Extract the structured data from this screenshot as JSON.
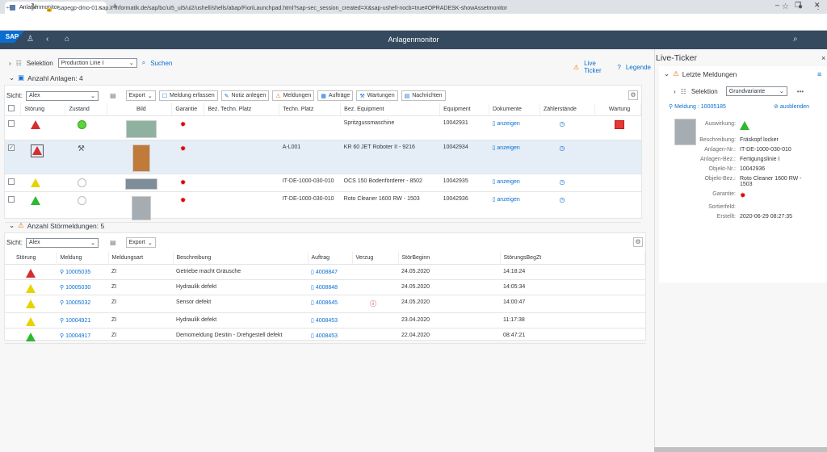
{
  "browser": {
    "tab_title": "Anlagenmonitor",
    "url": "sapegp-dmo-01.sap.it-informatik.de/sap/bc/ui5_ui5/ui2/ushell/shells/abap/FioriLaunchpad.html?sap-sec_session_created=X&sap-ushell-nocb=true#OPRADESK-showAssetmonitor"
  },
  "shell": {
    "title": "Anlagenmonitor",
    "logo": "SAP"
  },
  "filter": {
    "label": "Selektion",
    "variant": "Production Line I",
    "search": "Suchen",
    "live_ticker": "Live Ticker",
    "legend": "Legende"
  },
  "assets": {
    "title": "Anzahl Anlagen: 4",
    "view_label": "Sicht:",
    "view_value": "Alex",
    "export": "Export",
    "buttons": [
      "Meldung erfassen",
      "Notiz anlegen",
      "Meldungen",
      "Aufträge",
      "Wartungen",
      "Nachrichten"
    ],
    "columns": [
      "Störung",
      "Zustand",
      "Bild",
      "Garantie",
      "Bez. Techn. Platz",
      "Techn. Platz",
      "Bez. Equipment",
      "Equipment",
      "Dokumente",
      "Zählerstände",
      "Wartung"
    ],
    "rows": [
      {
        "stoerung": "red",
        "zustand": "green-circle",
        "platz": "",
        "bez_equipment": "Spritzgussmaschine",
        "equipment": "10042931",
        "doc": "anzeigen",
        "wartung": true,
        "selected": false
      },
      {
        "stoerung": "red",
        "zustand": "tool-icon",
        "platz": "A-L001",
        "bez_equipment": "KR 60 JET Roboter II - 9216",
        "equipment": "10042934",
        "doc": "anzeigen",
        "wartung": false,
        "selected": true
      },
      {
        "stoerung": "yellow",
        "zustand": "empty-circle",
        "platz": "IT-DE-1000-030-010",
        "bez_equipment": "OCS 150 Bodenförderer - 8502",
        "equipment": "10042935",
        "doc": "anzeigen",
        "wartung": false,
        "selected": false
      },
      {
        "stoerung": "green",
        "zustand": "empty-circle",
        "platz": "IT-DE-1000-030-010",
        "bez_equipment": "Roto Cleaner 1600 RW - 1503",
        "equipment": "10042936",
        "doc": "anzeigen",
        "wartung": false,
        "selected": false
      }
    ]
  },
  "faults": {
    "title": "Anzahl Störmeldungen: 5",
    "view_label": "Sicht:",
    "view_value": "Alex",
    "export": "Export",
    "columns": [
      "Störung",
      "Meldung",
      "Meldungsart",
      "Beschreibung",
      "Auftrag",
      "Verzug",
      "StörBeginn",
      "StörungsBegZt"
    ],
    "rows": [
      {
        "stoerung": "red",
        "meldung": "10005035",
        "art": "ZI",
        "beschreibung": "Getriebe macht Gräusche",
        "auftrag": "4008847",
        "verzug": false,
        "beginn": "24.05.2020",
        "zeit": "14:18:24"
      },
      {
        "stoerung": "yellow",
        "meldung": "10005030",
        "art": "ZI",
        "beschreibung": "Hydraulik defekt",
        "auftrag": "4008848",
        "verzug": false,
        "beginn": "24.05.2020",
        "zeit": "14:05:34"
      },
      {
        "stoerung": "yellow",
        "meldung": "10005032",
        "art": "ZI",
        "beschreibung": "Sensor defekt",
        "auftrag": "4008645",
        "verzug": true,
        "beginn": "24.05.2020",
        "zeit": "14:00:47"
      },
      {
        "stoerung": "yellow",
        "meldung": "10004921",
        "art": "ZI",
        "beschreibung": "Hydraulik defekt",
        "auftrag": "4008453",
        "verzug": false,
        "beginn": "23.04.2020",
        "zeit": "11:17:38"
      },
      {
        "stoerung": "green",
        "meldung": "10004917",
        "art": "ZI",
        "beschreibung": "Demomeldung Desitin - Drehgestell defekt",
        "auftrag": "4008453",
        "verzug": false,
        "beginn": "22.04.2020",
        "zeit": "08:47:21"
      }
    ]
  },
  "ticker": {
    "title": "Live-Ticker",
    "section": "Letzte Meldungen",
    "selektion": "Selektion",
    "variant": "Grundvariante",
    "meldung_link": "Meldung : 10005185",
    "ausblenden": "ausblenden",
    "fields": [
      {
        "label": "Auswirkung:",
        "value": ""
      },
      {
        "label": "Beschreibung:",
        "value": "Fräskopf locker"
      },
      {
        "label": "Anlagen-Nr.:",
        "value": "IT-DE-1000-030-010"
      },
      {
        "label": "Anlagen-Bez.:",
        "value": "Fertigungslinie I"
      },
      {
        "label": "Objekt-Nr.:",
        "value": "10042936"
      },
      {
        "label": "Objekt-Bez.:",
        "value": "Roto Cleaner 1600 RW - 1503"
      },
      {
        "label": "Garantie:",
        "value": ""
      },
      {
        "label": "Sortierfeld:",
        "value": ""
      },
      {
        "label": "Erstellt:",
        "value": "2020-06-29 08:27:35"
      }
    ]
  },
  "colors": {
    "shell": "#354a5f",
    "accent": "#0a6ed1",
    "red": "#d32f2f",
    "yellow": "#e6d400",
    "green": "#2eb82e"
  }
}
